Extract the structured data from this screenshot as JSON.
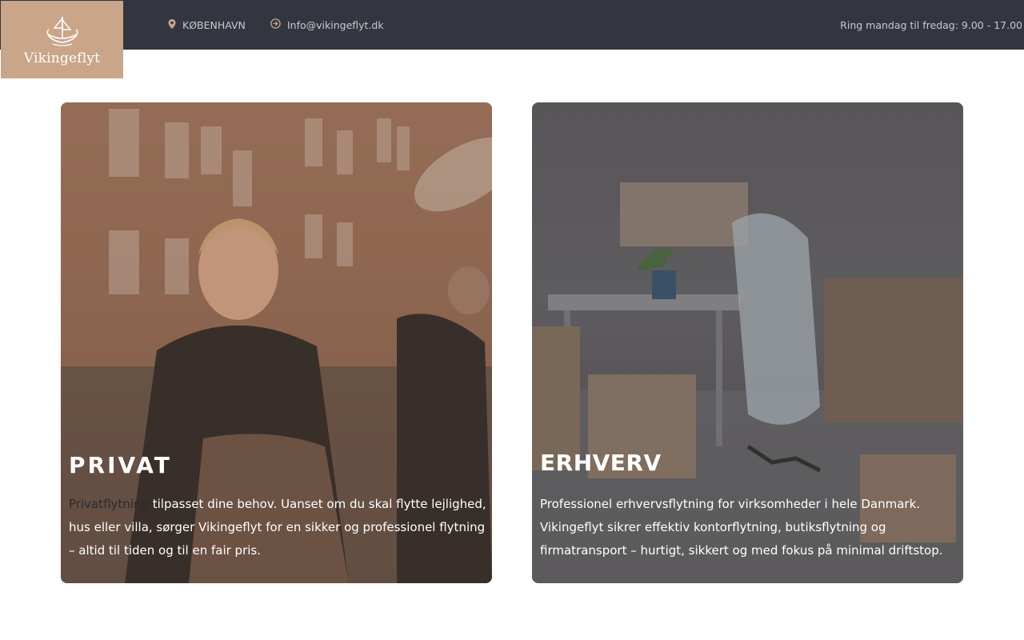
{
  "header": {
    "logo_text": "Vikingeflyt",
    "city": "KØBENHAVN",
    "email": "Info@vikingeflyt.dk",
    "hours": "Ring mandag til fredag: 9.00 - 17.00"
  },
  "icons": {
    "city_icon": "map-pin-icon",
    "email_icon": "arrow-circle-right-icon",
    "logo_icon": "viking-ship-icon"
  },
  "colors": {
    "topbar": "#33363f",
    "logo_bg": "#c9a68a",
    "accent": "#c9a68a"
  },
  "cards": [
    {
      "title": "PRIVAT",
      "link_text": "Privatflytning",
      "text": " tilpasset dine behov. Uanset om du skal flytte lejlighed, hus eller villa, sørger Vikingeflyt for en sikker og professionel flytning – altid til tiden og til en fair pris."
    },
    {
      "title": "ERHVERV",
      "text": "Professionel erhvervsflytning for virksomheder i hele Danmark. Vikingeflyt sikrer effektiv kontorflytning, butiksflytning og firmatransport – hurtigt, sikkert og med fokus på minimal driftstop."
    }
  ]
}
